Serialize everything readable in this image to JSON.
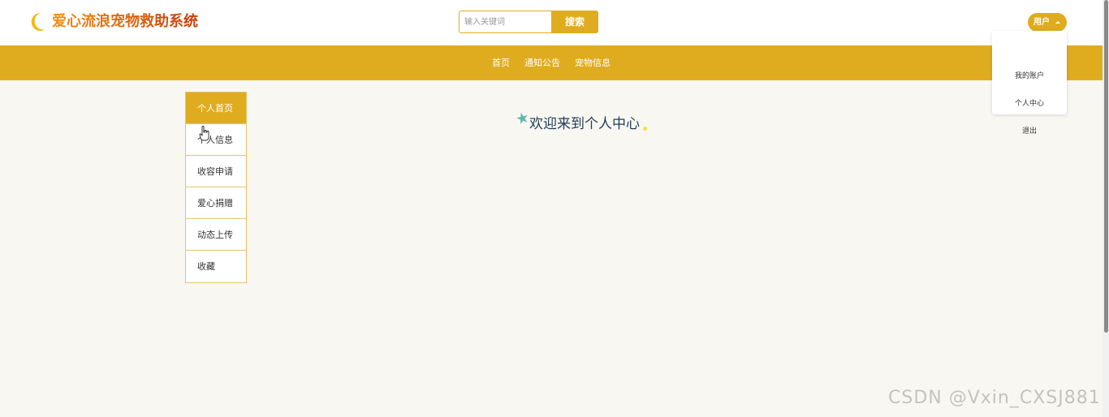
{
  "app": {
    "title": "爱心流浪宠物救助系统",
    "logo_icon": "crescent-moon-icon"
  },
  "colors": {
    "accent": "#e0ac1f",
    "logo_left": "#f08c12",
    "logo_right": "#c8440e",
    "page_bg": "#f8f7f1",
    "welcome_text": "#1f3d58"
  },
  "search": {
    "placeholder": "输入关键词",
    "value": "",
    "button_label": "搜索"
  },
  "user_menu": {
    "label": "用户",
    "items": [
      "我的账户",
      "个人中心",
      "退出"
    ]
  },
  "nav": {
    "items": [
      "首页",
      "通知公告",
      "宠物信息"
    ]
  },
  "sidebar": {
    "items": [
      {
        "label": "个人首页",
        "active": true
      },
      {
        "label": "个人信息",
        "active": false
      },
      {
        "label": "收容申请",
        "active": false
      },
      {
        "label": "爱心捐赠",
        "active": false
      },
      {
        "label": "动态上传",
        "active": false
      },
      {
        "label": "收藏",
        "active": false
      }
    ]
  },
  "main": {
    "welcome": "欢迎来到个人中心",
    "decor_icons": [
      "star-icon",
      "dot-icon"
    ]
  },
  "watermark": "CSDN @Vxin_CXSJ881"
}
